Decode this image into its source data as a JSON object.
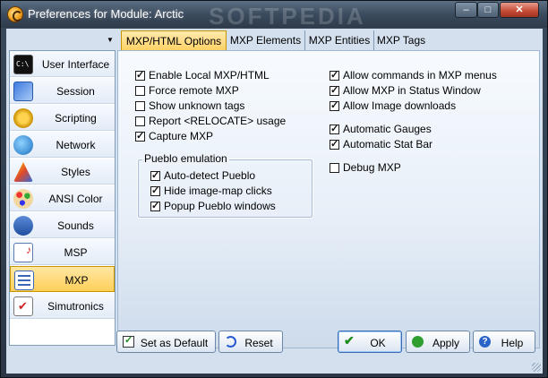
{
  "window": {
    "title": "Preferences for Module: Arctic",
    "watermark": "SOFTPEDIA",
    "controls": {
      "minimize": "–",
      "maximize": "□",
      "close": "✕"
    }
  },
  "sidebar": {
    "toggle": "▼",
    "items": [
      {
        "label": "User Interface",
        "icon": "console-icon"
      },
      {
        "label": "Session",
        "icon": "session-icon"
      },
      {
        "label": "Scripting",
        "icon": "scripting-icon"
      },
      {
        "label": "Network",
        "icon": "network-globe-icon"
      },
      {
        "label": "Styles",
        "icon": "styles-icon"
      },
      {
        "label": "ANSI Color",
        "icon": "palette-icon"
      },
      {
        "label": "Sounds",
        "icon": "sounds-icon"
      },
      {
        "label": "MSP",
        "icon": "music-note-icon"
      },
      {
        "label": "MXP",
        "icon": "mxp-list-icon",
        "active": true
      },
      {
        "label": "Simutronics",
        "icon": "checkmark-doc-icon"
      }
    ]
  },
  "tabs": [
    {
      "label": "MXP/HTML Options",
      "active": true
    },
    {
      "label": "MXP Elements"
    },
    {
      "label": "MXP Entities"
    },
    {
      "label": "MXP Tags"
    }
  ],
  "options_left": [
    {
      "label": "Enable Local MXP/HTML",
      "checked": true
    },
    {
      "label": "Force remote MXP",
      "checked": false
    },
    {
      "label": "Show unknown tags",
      "checked": false
    },
    {
      "label": "Report <RELOCATE> usage",
      "checked": false
    },
    {
      "label": "Capture MXP",
      "checked": true
    }
  ],
  "pueblo": {
    "title": "Pueblo emulation",
    "options": [
      {
        "label": "Auto-detect Pueblo",
        "checked": true
      },
      {
        "label": "Hide image-map clicks",
        "checked": true
      },
      {
        "label": "Popup Pueblo windows",
        "checked": true
      }
    ]
  },
  "options_right": [
    {
      "label": "Allow commands in MXP menus",
      "checked": true
    },
    {
      "label": "Allow MXP in Status Window",
      "checked": true
    },
    {
      "label": "Allow Image downloads",
      "checked": true
    },
    {
      "label": "Automatic Gauges",
      "checked": true
    },
    {
      "label": "Automatic Stat Bar",
      "checked": true
    },
    {
      "label": "Debug MXP",
      "checked": false
    }
  ],
  "buttons": {
    "set_default": "Set as Default",
    "reset": "Reset",
    "ok": "OK",
    "apply": "Apply",
    "help": "Help",
    "help_glyph": "?",
    "ok_glyph": "✔"
  }
}
